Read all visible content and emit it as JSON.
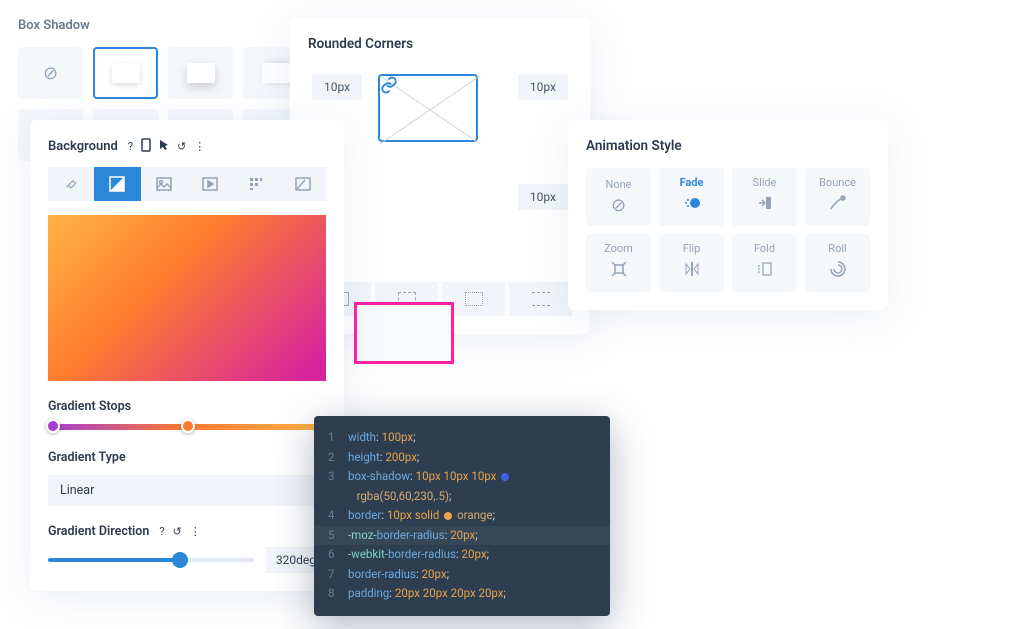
{
  "background": {
    "title": "Background",
    "gradient_stops_label": "Gradient Stops",
    "gradient_type_label": "Gradient Type",
    "gradient_type_value": "Linear",
    "gradient_direction_label": "Gradient Direction",
    "gradient_direction_value": "320deg"
  },
  "rounded_corners": {
    "title": "Rounded Corners",
    "tl": "10px",
    "tr": "10px",
    "br": "10px"
  },
  "animation": {
    "title": "Animation Style",
    "items": [
      "None",
      "Fade",
      "Slide",
      "Bounce",
      "Zoom",
      "Flip",
      "Fold",
      "Roll"
    ],
    "active": "Fade"
  },
  "box_shadow": {
    "title": "Box Shadow"
  },
  "code": {
    "lines": [
      {
        "n": "1",
        "prop": "width",
        "val": "100px"
      },
      {
        "n": "2",
        "prop": "height",
        "val": "200px"
      },
      {
        "n": "3",
        "prop": "box-shadow",
        "val": "10px 10px 10px",
        "extra_rgba": "rgba(50,60,230,.5)"
      },
      {
        "n": "4",
        "prop": "border",
        "val": "10px solid",
        "color_name": "orange"
      },
      {
        "n": "5",
        "prop": "-moz-border-radius",
        "val": "20px"
      },
      {
        "n": "6",
        "prop": "-webkit-border-radius",
        "val": "20px"
      },
      {
        "n": "7",
        "prop": "border-radius",
        "val": "20px"
      },
      {
        "n": "8",
        "prop": "padding",
        "val": "20px 20px 20px 20px"
      }
    ]
  }
}
